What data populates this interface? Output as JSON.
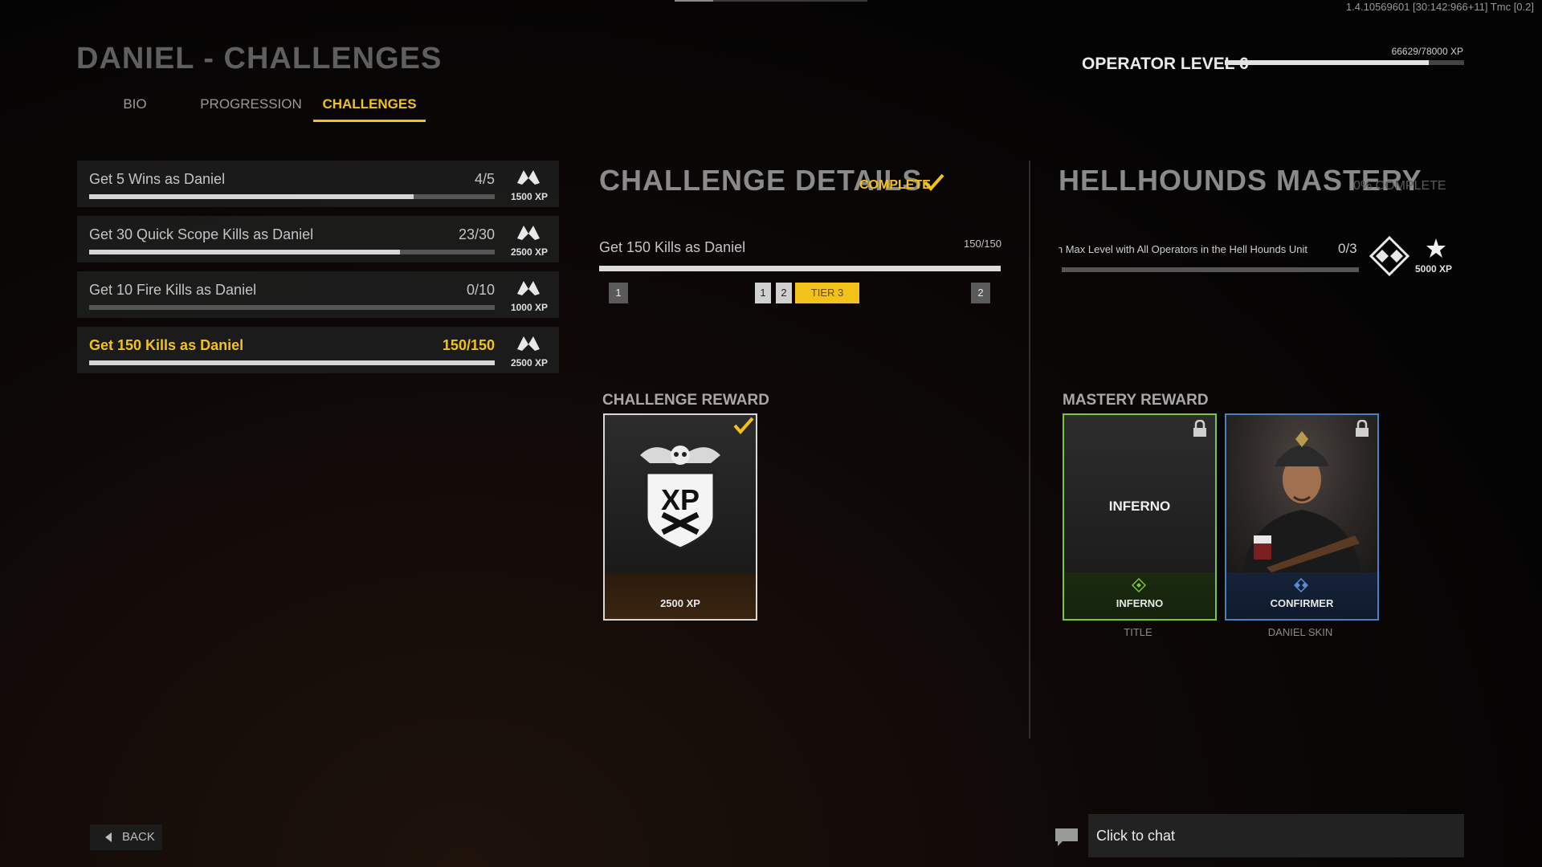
{
  "build_info": "1.4.10569601 [30:142:966+11] Tmc [0.2]",
  "page_title": "DANIEL - CHALLENGES",
  "tabs": [
    {
      "label": "BIO",
      "active": false
    },
    {
      "label": "PROGRESSION",
      "active": false
    },
    {
      "label": "CHALLENGES",
      "active": true
    }
  ],
  "operator": {
    "level_label": "OPERATOR LEVEL 6",
    "xp_text": "66629/78000 XP",
    "xp_progress": 0.854
  },
  "challenges": [
    {
      "name": "Get 5 Wins as Daniel",
      "count": "4/5",
      "xp": "1500 XP",
      "progress": 0.8,
      "active": false
    },
    {
      "name": "Get 30 Quick Scope Kills as Daniel",
      "count": "23/30",
      "xp": "2500 XP",
      "progress": 0.7667,
      "active": false
    },
    {
      "name": "Get 10 Fire Kills as Daniel",
      "count": "0/10",
      "xp": "1000 XP",
      "progress": 0,
      "active": false
    },
    {
      "name": "Get 150 Kills as Daniel",
      "count": "150/150",
      "xp": "2500 XP",
      "progress": 1,
      "active": true
    }
  ],
  "challenge_details": {
    "title": "CHALLENGE DETAILS",
    "status": "COMPLETE",
    "name": "Get 150 Kills as Daniel",
    "count": "150/150",
    "progress": 1,
    "tiers": {
      "left": "1",
      "mid_a": "1",
      "mid_b": "2",
      "current": "TIER 3",
      "right": "2"
    }
  },
  "mastery": {
    "title": "HELLHOUNDS MASTERY",
    "percent": "0% COMPLETE",
    "challenge_name": "Reach Max Level with All Operators in the Hell Hounds Unit",
    "count": "0/3",
    "progress": 0,
    "xp": "5000 XP"
  },
  "challenge_reward": {
    "label": "CHALLENGE REWARD",
    "card_label": "2500 XP",
    "art_text": "XP"
  },
  "mastery_reward": {
    "label": "MASTERY REWARD",
    "cards": [
      {
        "label": "INFERNO",
        "art_text": "INFERNO",
        "type": "TITLE",
        "border_color": "#7cc63b"
      },
      {
        "label": "CONFIRMER",
        "type": "DANIEL SKIN",
        "border_color": "#4a7fc0"
      }
    ]
  },
  "back_label": "BACK",
  "chat_placeholder": "Click to chat",
  "colors": {
    "accent": "#f2c21a",
    "background": "#050404"
  }
}
